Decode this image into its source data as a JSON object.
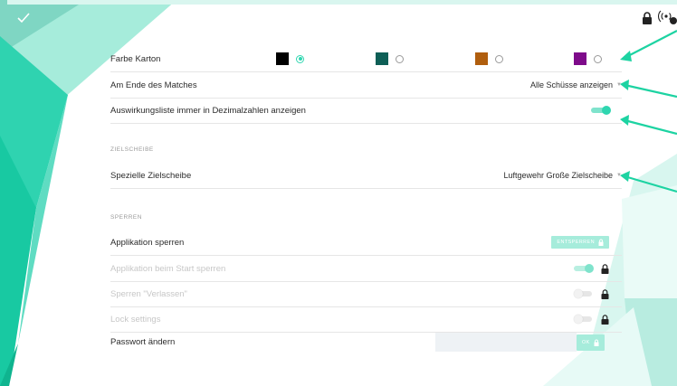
{
  "window": {
    "check_icon": "checkmark-icon"
  },
  "status": {
    "lock_icon": "lock-icon",
    "signal_icon": "wireless-icon"
  },
  "colors": {
    "accent": "#2fd6b0",
    "accent_light": "#a6ecdb",
    "arrow": "#1dd3a2"
  },
  "settings": {
    "color_label": "Farbe Karton",
    "color_options": [
      {
        "color": "#000000",
        "selected": true
      },
      {
        "color": "#0e5f56",
        "selected": false
      },
      {
        "color": "#b05e0e",
        "selected": false
      },
      {
        "color": "#7e0b8a",
        "selected": false
      }
    ],
    "end_of_match_label": "Am Ende des Matches",
    "end_of_match_value": "Alle Schüsse anzeigen",
    "decimal_label": "Auswirkungsliste immer in Dezimalzahlen anzeigen",
    "decimal_on": true
  },
  "target_section": {
    "title": "ZIELSCHEIBE",
    "special_label": "Spezielle Zielscheibe",
    "special_value": "Luftgewehr Große Zielscheibe"
  },
  "lock_section": {
    "title": "SPERREN",
    "lock_app_label": "Applikation sperren",
    "unlock_button": "ENTSPERREN",
    "lock_on_start_label": "Applikation beim Start sperren",
    "lock_on_start_on": true,
    "lock_exit_label": "Sperren \"Verlassen\"",
    "lock_exit_on": false,
    "lock_settings_label": "Lock settings",
    "lock_settings_on": false,
    "password_label": "Passwort ändern",
    "ok_button": "OK"
  }
}
